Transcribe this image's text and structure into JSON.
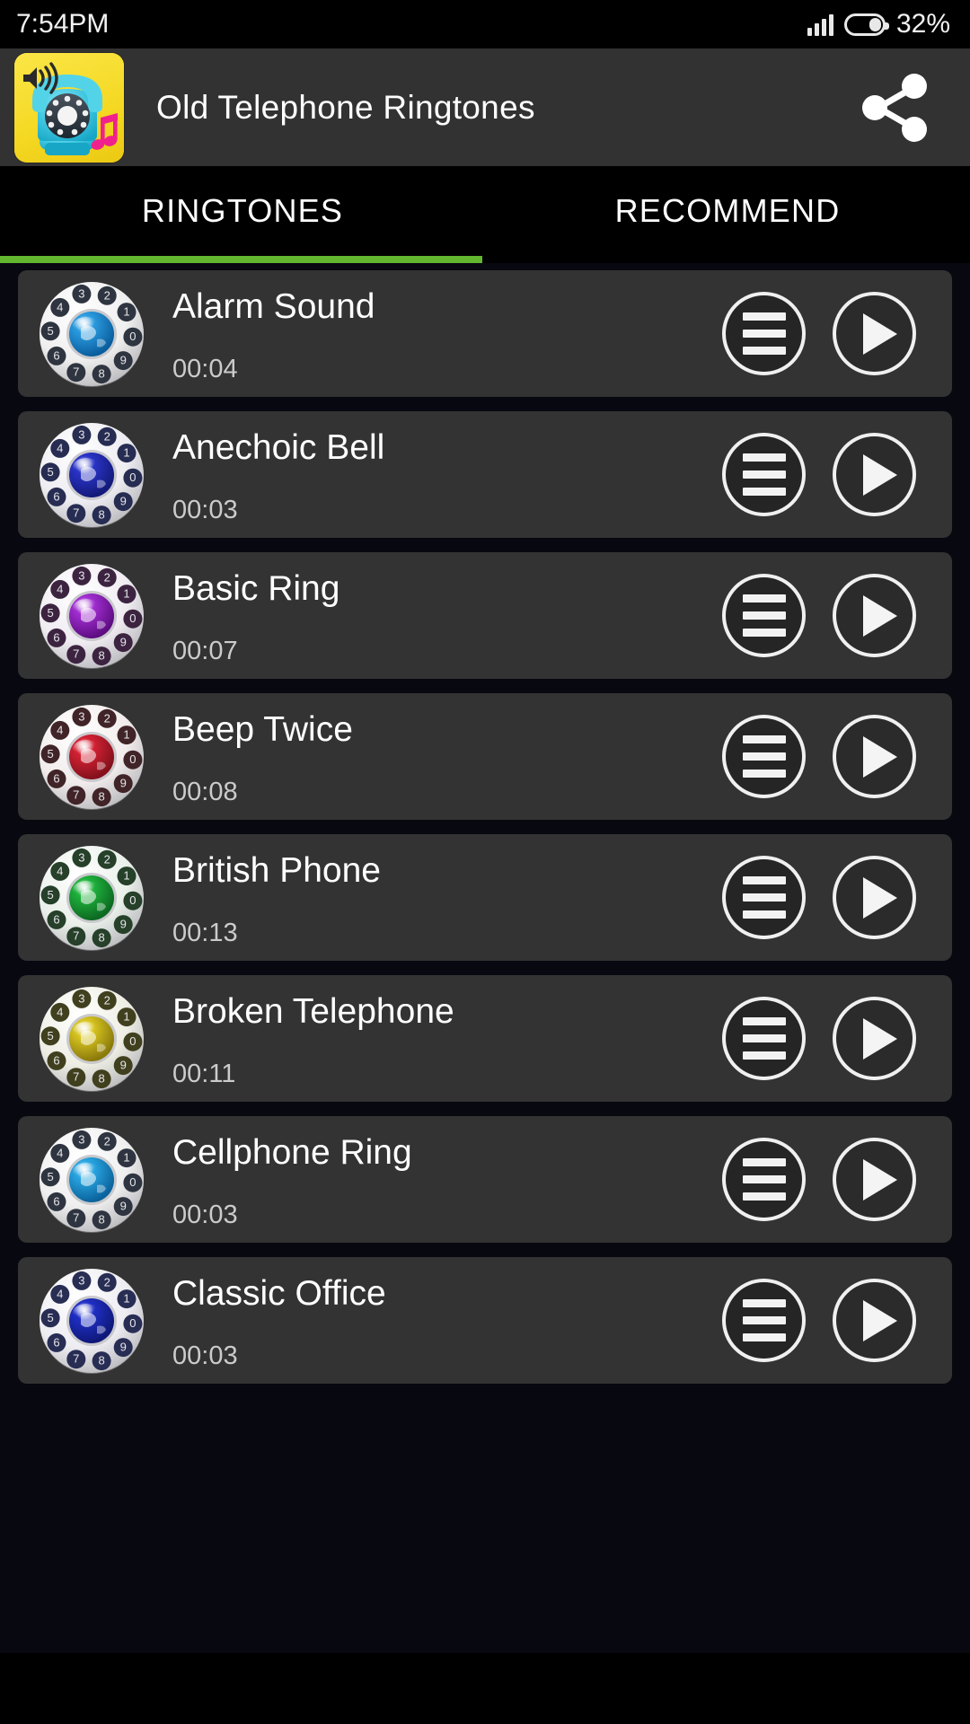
{
  "status_bar": {
    "time": "7:54PM",
    "battery_percent": "32%",
    "signal_icon": "signal-bars-icon",
    "battery_icon": "battery-icon"
  },
  "app_bar": {
    "title": "Old Telephone Ringtones",
    "app_icon": "old-telephone-app-icon",
    "share_icon": "share-icon"
  },
  "tabs": [
    {
      "label": "RINGTONES",
      "active": true
    },
    {
      "label": "RECOMMEND",
      "active": false
    }
  ],
  "theme": {
    "accent_green": "#62b630",
    "app_bar_bg": "#323232",
    "card_bg": "#333333",
    "page_bg": "#080810",
    "status_bg": "#000000",
    "title_color": "#ffffff",
    "duration_color": "#cbcbcb",
    "icon_yellow": "#f4d822",
    "phone_cyan": "#3fc6e0"
  },
  "row_actions": {
    "menu_label": "menu-button",
    "play_label": "play-button"
  },
  "ringtones": [
    {
      "title": "Alarm Sound",
      "duration": "00:04",
      "globe_color": "#2b9ce0",
      "globe_color_dark": "#0a5e9e",
      "dial_face": "#efefef",
      "hole_color": "#2f3540"
    },
    {
      "title": "Anechoic Bell",
      "duration": "00:03",
      "globe_color": "#2a34c8",
      "globe_color_dark": "#131a7a",
      "dial_face": "#ededf2",
      "hole_color": "#272c52"
    },
    {
      "title": "Basic Ring",
      "duration": "00:07",
      "globe_color": "#a22ed2",
      "globe_color_dark": "#5e0d82",
      "dial_face": "#f0ecf2",
      "hole_color": "#3c2440"
    },
    {
      "title": "Beep Twice",
      "duration": "00:08",
      "globe_color": "#d42233",
      "globe_color_dark": "#84101c",
      "dial_face": "#f2ecec",
      "hole_color": "#402427"
    },
    {
      "title": "British Phone",
      "duration": "00:13",
      "globe_color": "#1fb23c",
      "globe_color_dark": "#0c6a22",
      "dial_face": "#eaf0ea",
      "hole_color": "#26402a"
    },
    {
      "title": "Broken Telephone",
      "duration": "00:11",
      "globe_color": "#d8c520",
      "globe_color_dark": "#8a7a0c",
      "dial_face": "#eeeee4",
      "hole_color": "#40401f"
    },
    {
      "title": "Cellphone Ring",
      "duration": "00:03",
      "globe_color": "#29a6e2",
      "globe_color_dark": "#0b639c",
      "dial_face": "#efefef",
      "hole_color": "#2f3540"
    },
    {
      "title": "Classic Office",
      "duration": "00:03",
      "globe_color": "#1f2fc6",
      "globe_color_dark": "#0f1878",
      "dial_face": "#ededf2",
      "hole_color": "#282d54"
    }
  ]
}
